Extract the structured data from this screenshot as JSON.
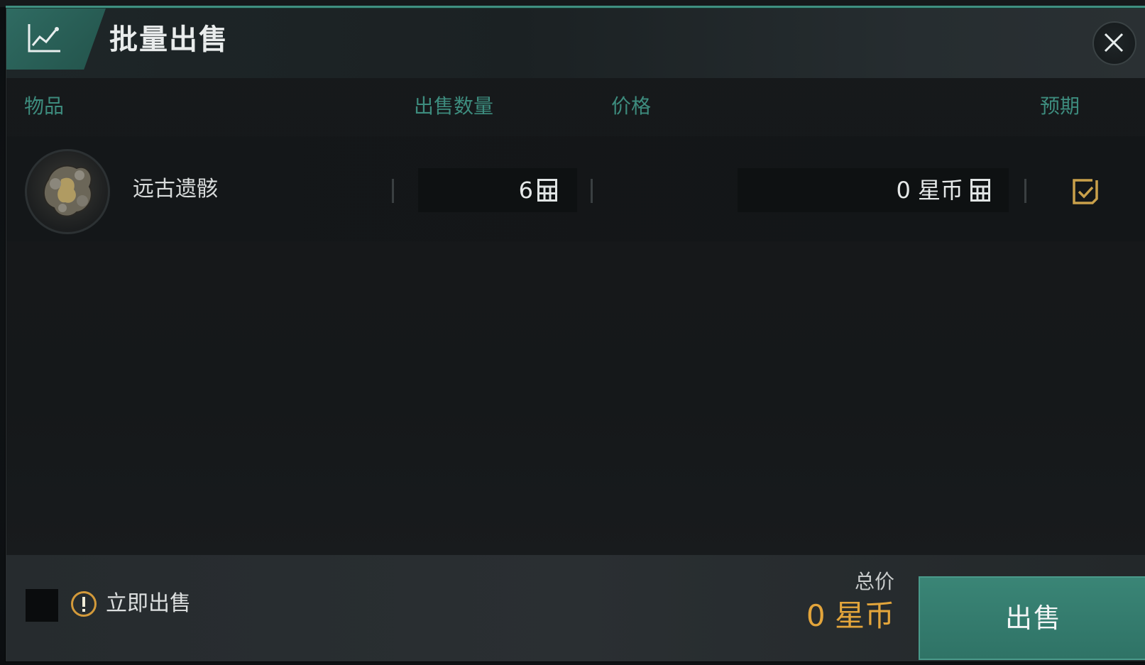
{
  "header": {
    "title": "批量出售",
    "icon": "chart-trend-icon",
    "close_icon": "close-icon"
  },
  "columns": {
    "item": "物品",
    "quantity": "出售数量",
    "price": "价格",
    "expected": "预期"
  },
  "rows": [
    {
      "name": "远古遗骸",
      "quantity": "6",
      "price": "0 星币",
      "expected_icon": "checkbox-checked-icon"
    }
  ],
  "footer": {
    "instant_sell_label": "立即出售",
    "total_label": "总价",
    "total_value": "0 星币",
    "sell_button": "出售"
  },
  "colors": {
    "accent_teal": "#3d8c7e",
    "sell_button": "#3a8576",
    "total_gold": "#e3a53b"
  }
}
